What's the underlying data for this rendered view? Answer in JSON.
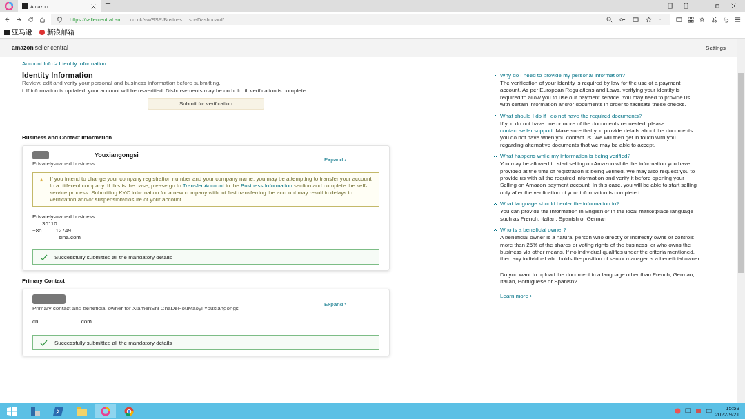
{
  "browser": {
    "tab_title": "Amazon",
    "url_segments": [
      "https://sellercentral.am",
      ".co.uk/sw/SSR/Busines",
      "spaDashboard/"
    ],
    "bookmarks": [
      "亚马逊",
      "新浪邮箱"
    ]
  },
  "header": {
    "logo_brand": "amazon",
    "logo_product": "seller central",
    "settings": "Settings"
  },
  "breadcrumb": "Account Info > Identity Information",
  "page": {
    "title": "Identity Information",
    "subtitle": "Review, edit and verify your personal and business information before submitting.",
    "notice_icon": "i",
    "notice": "If information is updated, your account will be re-verified. Disbursements may be on hold till verification is complete.",
    "submit_button": "Submit for verification"
  },
  "sections": [
    {
      "heading": "Business and Contact Information",
      "name": "Youxiangongsi",
      "role": "Privately-owned business",
      "expand": "Expand ›",
      "warning": [
        "If you intend to change your company registration number and your company name, you may be attempting to transfer your account to a different company. If this is the case, please go to ",
        "Transfer Account",
        " in the ",
        "Business Information",
        " section and complete the self-service process. Submitting KYC information for a new company without first transferring the account may result in delays to verification and/or suspension/closure of your account."
      ],
      "details": [
        "Privately-owned business",
        "36110",
        "+86",
        "12749",
        "sina.com"
      ],
      "status": "Successfully submitted all the mandatory details"
    },
    {
      "heading": "Primary Contact",
      "role": "Primary contact and beneficial owner for XiamenShi ChaDeHouMaoyi Youxiangongsi",
      "expand": "Expand ›",
      "details": [
        "ch",
        ".com"
      ],
      "status": "Successfully submitted all the mandatory details"
    }
  ],
  "faq": [
    {
      "question": "Why do I need to provide my personal information?",
      "expanded": true,
      "answer": [
        "The verification of your identity is required by law for the use of a payment account. As per European Regulations and Laws, verifying your identity is required to allow you to use our payment service. You may need to provide us with certain information and/or documents in order to facilitate these checks."
      ]
    },
    {
      "question": "What should I do if I do not have the required documents?",
      "expanded": true,
      "answer": [
        "If you do not have one or more of the documents requested, please ",
        "contact seller support",
        ". Make sure that you provide details about the documents you do not have when you contact us. We will then get in touch with you regarding alternative documents that we may be able to accept."
      ]
    },
    {
      "question": "What happens while my information is being verified?",
      "expanded": true,
      "answer": [
        "You may be allowed to start selling on Amazon while the information you have provided at the time of registration is being verified. We may also request you to provide us with all the required information and verify it before opening your Selling on Amazon payment account. In this case, you will be able to start selling only after the verification of your information is completed."
      ]
    },
    {
      "question": "What language should I enter the information in?",
      "expanded": true,
      "answer": [
        "You can provide the information in English or in the local marketplace language such as French, Italian, Spanish or German"
      ]
    },
    {
      "question": "Who is a beneficial owner?",
      "expanded": true,
      "answer": [
        "A beneficial owner is a natural person who directly or indirectly owns or controls more than 25% of the shares or voting rights of the business, or who owns the business via other means. If no individual qualifies under the criteria mentioned, then any individual who holds the position of senior manager is a beneficial owner"
      ]
    }
  ],
  "faq_footer": "Do you want to upload the document in a language other than French, German, Italian, Portuguese or Spanish?",
  "learn_more": "Learn more ›",
  "taskbar": {
    "time": "15:53",
    "date": "2022/9/21"
  }
}
